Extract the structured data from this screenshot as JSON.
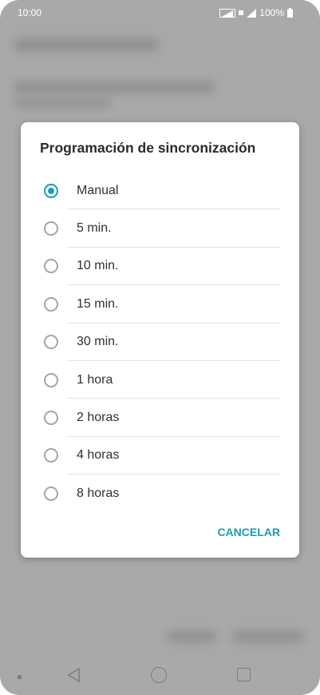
{
  "status_bar": {
    "time": "10:00",
    "battery": "100%"
  },
  "dialog": {
    "title": "Programación de sincronización",
    "options": [
      {
        "label": "Manual",
        "selected": true
      },
      {
        "label": "5 min.",
        "selected": false
      },
      {
        "label": "10 min.",
        "selected": false
      },
      {
        "label": "15 min.",
        "selected": false
      },
      {
        "label": "30 min.",
        "selected": false
      },
      {
        "label": "1 hora",
        "selected": false
      },
      {
        "label": "2 horas",
        "selected": false
      },
      {
        "label": "4 horas",
        "selected": false
      },
      {
        "label": "8 horas",
        "selected": false
      }
    ],
    "cancel_label": "CANCELAR"
  },
  "colors": {
    "accent": "#1a9db5",
    "scrim": "#a9a9a9"
  }
}
